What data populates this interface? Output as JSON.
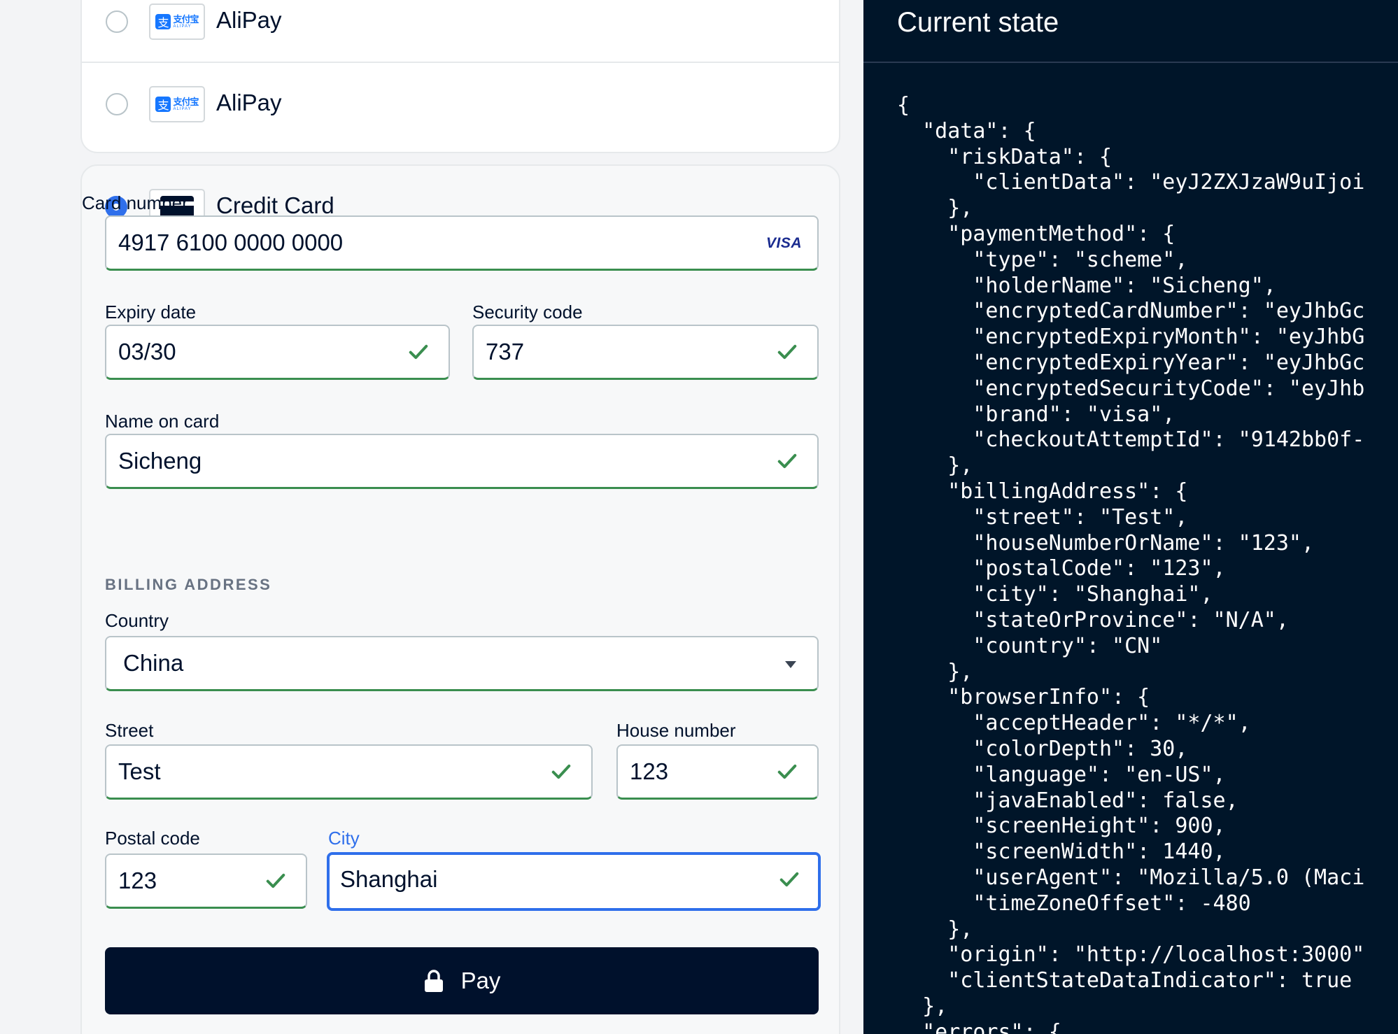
{
  "payment_methods": [
    {
      "label": "AliPay",
      "logo_cn": "支付宝",
      "logo_en": "ALIPAY",
      "icon": "alipay-icon"
    },
    {
      "label": "AliPay",
      "logo_cn": "支付宝",
      "logo_en": "ALIPAY",
      "icon": "alipay-icon"
    }
  ],
  "credit_card": {
    "label": "Credit Card",
    "card_number": {
      "label": "Card number",
      "value": "4917 6100 0000 0000",
      "brand": "VISA"
    },
    "expiry": {
      "label": "Expiry date",
      "value": "03/30"
    },
    "security": {
      "label": "Security code",
      "value": "737"
    },
    "name": {
      "label": "Name on card",
      "value": "Sicheng"
    }
  },
  "billing": {
    "section_label": "BILLING ADDRESS",
    "country": {
      "label": "Country",
      "value": "China"
    },
    "street": {
      "label": "Street",
      "value": "Test"
    },
    "house": {
      "label": "House number",
      "value": "123"
    },
    "postal": {
      "label": "Postal code",
      "value": "123"
    },
    "city": {
      "label": "City",
      "value": "Shanghai"
    }
  },
  "pay_button": {
    "label": "Pay",
    "icon": "lock-icon"
  },
  "state_panel": {
    "title": "Current state",
    "lines": [
      "{",
      "  \"data\": {",
      "    \"riskData\": {",
      "      \"clientData\": \"eyJ2ZXJzaW9uIjoi",
      "    },",
      "    \"paymentMethod\": {",
      "      \"type\": \"scheme\",",
      "      \"holderName\": \"Sicheng\",",
      "      \"encryptedCardNumber\": \"eyJhbGc",
      "      \"encryptedExpiryMonth\": \"eyJhbG",
      "      \"encryptedExpiryYear\": \"eyJhbGc",
      "      \"encryptedSecurityCode\": \"eyJhb",
      "      \"brand\": \"visa\",",
      "      \"checkoutAttemptId\": \"9142bb0f-",
      "    },",
      "    \"billingAddress\": {",
      "      \"street\": \"Test\",",
      "      \"houseNumberOrName\": \"123\",",
      "      \"postalCode\": \"123\",",
      "      \"city\": \"Shanghai\",",
      "      \"stateOrProvince\": \"N/A\",",
      "      \"country\": \"CN\"",
      "    },",
      "    \"browserInfo\": {",
      "      \"acceptHeader\": \"*/*\",",
      "      \"colorDepth\": 30,",
      "      \"language\": \"en-US\",",
      "      \"javaEnabled\": false,",
      "      \"screenHeight\": 900,",
      "      \"screenWidth\": 1440,",
      "      \"userAgent\": \"Mozilla/5.0 (Maci",
      "      \"timeZoneOffset\": -480",
      "    },",
      "    \"origin\": \"http://localhost:3000\"",
      "    \"clientStateDataIndicator\": true",
      "  },",
      "  \"errors\": {"
    ]
  },
  "colors": {
    "accent": "#2f6feb",
    "valid": "#3a8e4f",
    "dark": "#00112c",
    "panel": "#001529"
  }
}
